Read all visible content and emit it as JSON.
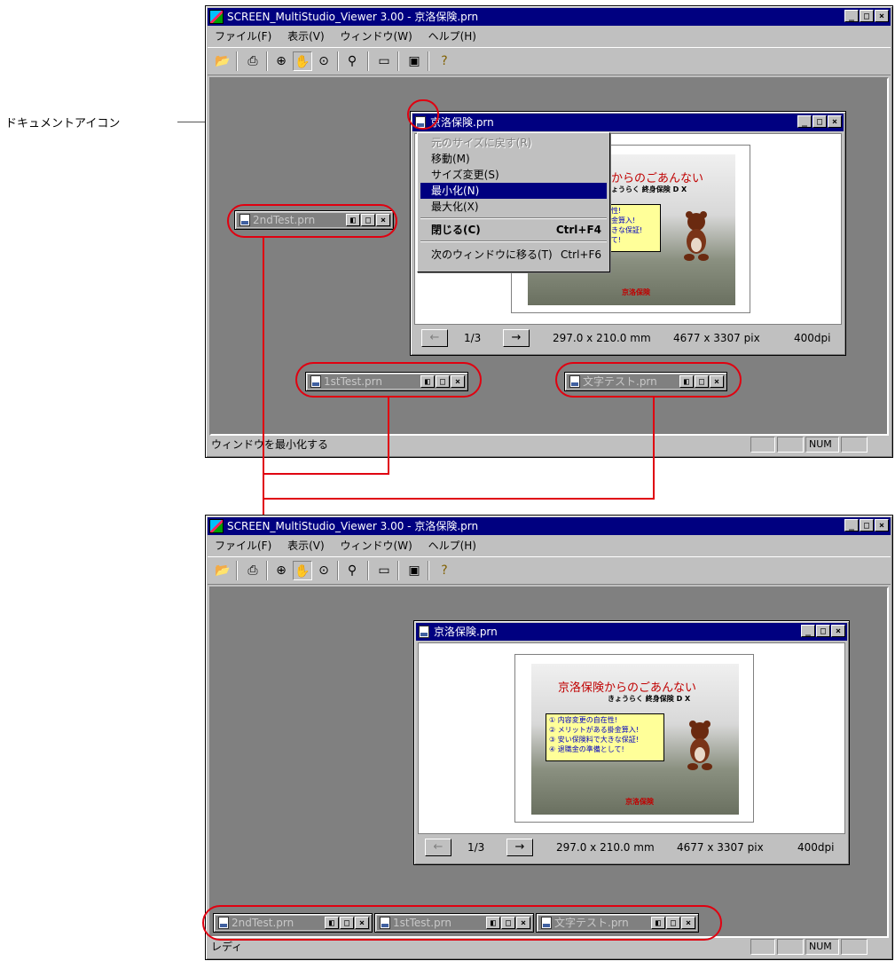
{
  "annotation": {
    "label": "ドキュメントアイコン"
  },
  "app": {
    "title": "SCREEN_MultiStudio_Viewer 3.00 - 京洛保険.prn",
    "menu": [
      "ファイル(F)",
      "表示(V)",
      "ウィンドウ(W)",
      "ヘルプ(H)"
    ],
    "toolbar_icons": [
      "open-folder-icon",
      "print-icon",
      "zoom-in-icon",
      "hand-icon",
      "rotate-icon",
      "person-icon",
      "page-view-icon",
      "window-image-icon",
      "help-icon"
    ]
  },
  "window1": {
    "status_text": "ウィンドウを最小化する",
    "status_num": "NUM"
  },
  "window2": {
    "status_text": "レディ",
    "status_num": "NUM"
  },
  "doc": {
    "title": "京洛保険.prn",
    "page": "1/3",
    "size_mm": "297.0 x 210.0 mm",
    "size_pix": "4677 x 3307 pix",
    "dpi": "400dpi",
    "prev_label": "←",
    "next_label": "→",
    "page_title": "京洛保険からのごあんない",
    "page_title_partial": "からのごあんない",
    "page_subtitle": "きょうらく 終身保険 D X",
    "box_lines": [
      "① 内容変更の自在性!",
      "② メリットがある掛金算入!",
      "③ 安い保険料で大きな保証!",
      "④ 退職金の準備として!"
    ],
    "box_partial": [
      "在性!",
      "掛金算入!",
      "大きな保証!",
      "して!"
    ],
    "logo_text": "京洛保険"
  },
  "sysmenu": {
    "items": [
      {
        "label": "元のサイズに戻す(R)",
        "state": "disabled"
      },
      {
        "label": "移動(M)",
        "state": "normal"
      },
      {
        "label": "サイズ変更(S)",
        "state": "normal"
      },
      {
        "label": "最小化(N)",
        "state": "selected"
      },
      {
        "label": "最大化(X)",
        "state": "normal"
      },
      {
        "label": "閉じる(C)",
        "shortcut": "Ctrl+F4",
        "state": "bold"
      },
      {
        "label": "次のウィンドウに移る(T)",
        "shortcut": "Ctrl+F6",
        "state": "normal"
      }
    ]
  },
  "minimized": {
    "second": "2ndTest.prn",
    "first": "1stTest.prn",
    "moji": "文字テスト.prn"
  },
  "colors": {
    "annotation": "#e00010",
    "titlebar": "#000080",
    "face": "#c0c0c0",
    "mdi_bg": "#808080"
  }
}
